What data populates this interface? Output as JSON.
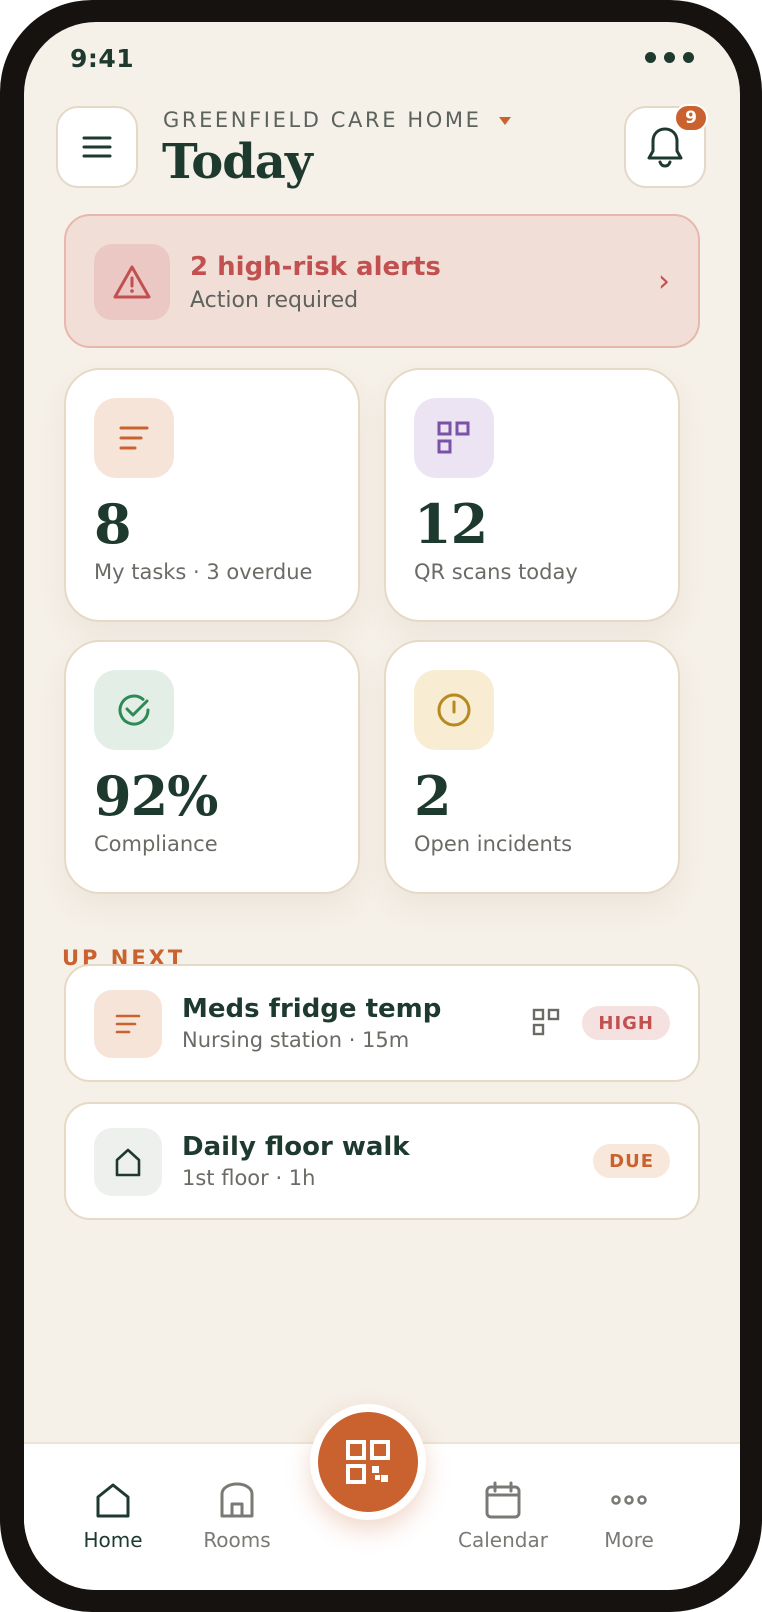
{
  "status_bar": {
    "time": "9:41"
  },
  "header": {
    "org_name": "GREENFIELD CARE HOME",
    "title": "Today",
    "notification_count": "9"
  },
  "alert": {
    "title": "2 high-risk alerts",
    "subtitle": "Action required",
    "chevron": "›"
  },
  "stats": [
    {
      "value": "8",
      "label": "My tasks · 3 overdue",
      "icon": "list-icon",
      "tint": "#f6e4d9",
      "color": "#c9622e"
    },
    {
      "value": "12",
      "label": "QR scans today",
      "icon": "qr-icon",
      "tint": "#ece4f2",
      "color": "#7a52a8"
    },
    {
      "value": "92%",
      "label": "Compliance",
      "icon": "check-circle-icon",
      "tint": "#e2eee6",
      "color": "#2e8a55"
    },
    {
      "value": "2",
      "label": "Open incidents",
      "icon": "alert-circle-icon",
      "tint": "#f8ecd2",
      "color": "#b8891f"
    }
  ],
  "up_next": {
    "label": "UP NEXT",
    "items": [
      {
        "title": "Meds fridge temp",
        "subtitle": "Nursing station · 15m",
        "badge": "HIGH",
        "icon": "list-icon"
      },
      {
        "title": "Daily floor walk",
        "subtitle": "1st floor · 1h",
        "badge": "DUE",
        "icon": "house-icon"
      }
    ]
  },
  "nav": {
    "items": [
      {
        "label": "Home",
        "icon": "home-icon",
        "active": true
      },
      {
        "label": "Rooms",
        "icon": "room-icon"
      },
      {
        "label": "Calendar",
        "icon": "calendar-icon"
      },
      {
        "label": "More",
        "icon": "more-icon"
      }
    ],
    "scan_button_icon": "qr-scan-icon"
  },
  "colors": {
    "accent": "#c9622e",
    "text_primary": "#1e3a2f",
    "background": "#f5f0e8",
    "alert_red": "#c25050"
  }
}
